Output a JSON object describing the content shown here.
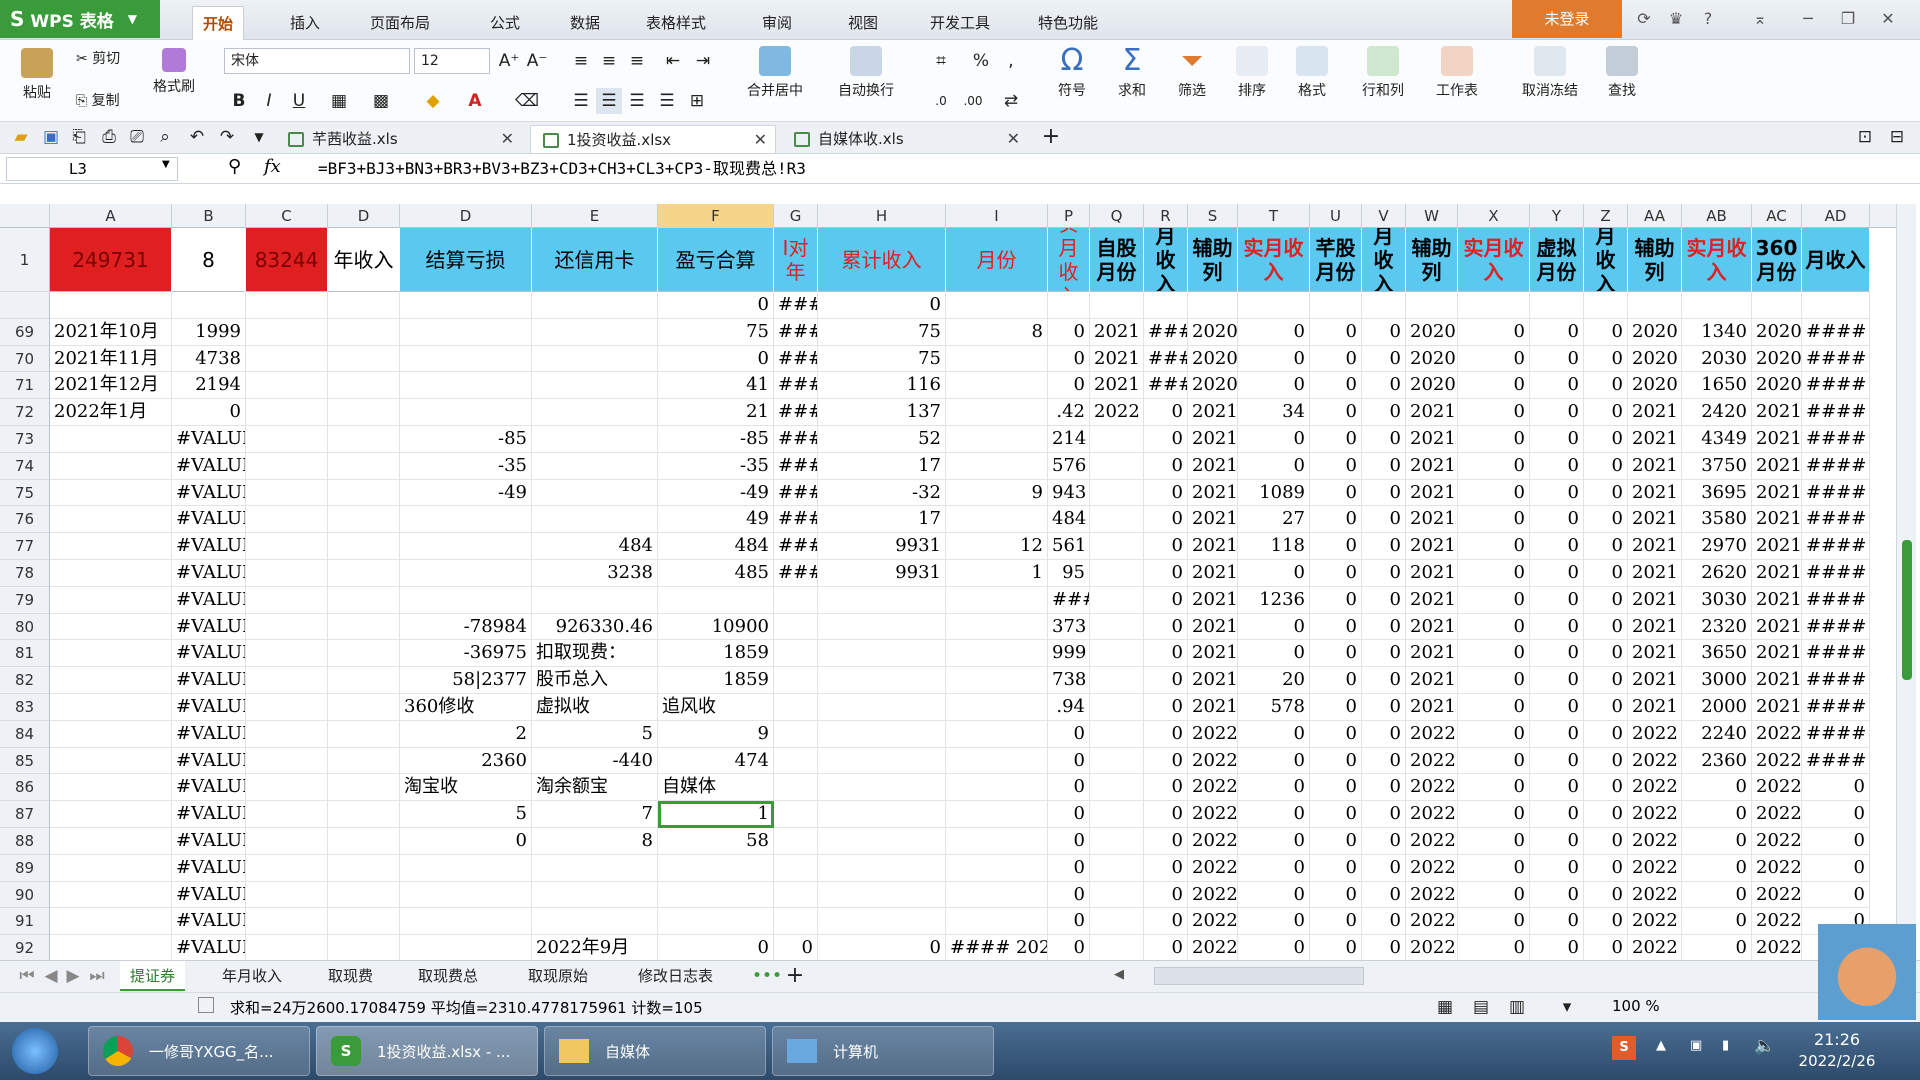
{
  "app": {
    "name": "WPS 表格",
    "login": "未登录"
  },
  "menu_tabs": [
    "开始",
    "插入",
    "页面布局",
    "公式",
    "数据",
    "表格样式",
    "审阅",
    "视图",
    "开发工具",
    "特色功能"
  ],
  "ribbon": {
    "paste": "粘贴",
    "cut": "剪切",
    "copy": "复制",
    "format_painter": "格式刷",
    "font": "宋体",
    "size": "12",
    "merge": "合并居中",
    "wrap": "自动换行",
    "symbol": "符号",
    "sum": "求和",
    "filter": "筛选",
    "sort": "排序",
    "format": "格式",
    "rowcol": "行和列",
    "worksheet": "工作表",
    "freeze": "取消冻结",
    "find": "查找"
  },
  "files": [
    {
      "name": "芊茜收益.xls",
      "active": false
    },
    {
      "name": "1投资收益.xlsx",
      "active": true
    },
    {
      "name": "自媒体收.xls",
      "active": false
    }
  ],
  "formula_bar": {
    "cell": "L3",
    "formula": "=BF3+BJ3+BN3+BR3+BV3+BZ3+CD3+CH3+CL3+CP3-取现费总!R3"
  },
  "columns": [
    "A",
    "B",
    "C",
    "D",
    "D",
    "E",
    "F",
    "G",
    "H",
    "I",
    "P",
    "Q",
    "R",
    "S",
    "T",
    "U",
    "V",
    "W",
    "X",
    "Y",
    "Z",
    "AA",
    "AB",
    "AC",
    "AD"
  ],
  "header_row": {
    "A": "249731",
    "B": "8",
    "C": "83244",
    "D1": "年收入",
    "D": "结算亏损",
    "E": "还信用卡",
    "F": "盈亏合算",
    "G": "I对年",
    "H": "累计收入",
    "I": "月份",
    "P": "实月收入",
    "Q": "自股月份",
    "R": "月收入",
    "S": "辅助列",
    "T": "实月收入",
    "U": "芊股月份",
    "V": "月收入",
    "W": "辅助列",
    "X": "实月收入",
    "Y": "虚拟月份",
    "Z": "月收入",
    "AA": "辅助列",
    "AB": "实月收入",
    "AC": "360月份",
    "AD": "月收入"
  },
  "rows": [
    {
      "n": "",
      "A": "",
      "B": "",
      "D": "",
      "E": "",
      "F": "0",
      "G": "###",
      "H": "0",
      "I": "",
      "P": "",
      "Q": "",
      "R": "",
      "S": "",
      "T": "",
      "U": "",
      "V": "",
      "W": "",
      "X": "",
      "Y": "",
      "Z": "",
      "AA": "",
      "AB": "",
      "AC": "",
      "AD": ""
    },
    {
      "n": "69",
      "A": "2021年10月",
      "B": "1999",
      "D": "",
      "E": "",
      "F": "75",
      "G": "###",
      "H": "75",
      "I": "8",
      "P": "0",
      "Q": "2021",
      "R": "####",
      "S": "2020",
      "T": "0",
      "U": "0",
      "V": "0",
      "W": "2020",
      "X": "0",
      "Y": "0",
      "Z": "0",
      "AA": "2020",
      "AB": "1340",
      "AC": "2020",
      "AD": "####"
    },
    {
      "n": "70",
      "A": "2021年11月",
      "B": "4738",
      "D": "",
      "E": "",
      "F": "0",
      "G": "###",
      "H": "75",
      "I": "",
      "P": "0",
      "Q": "2021",
      "R": "####",
      "S": "2020",
      "T": "0",
      "U": "0",
      "V": "0",
      "W": "2020",
      "X": "0",
      "Y": "0",
      "Z": "0",
      "AA": "2020",
      "AB": "2030",
      "AC": "2020",
      "AD": "####"
    },
    {
      "n": "71",
      "A": "2021年12月",
      "B": "2194",
      "D": "",
      "E": "",
      "F": "41",
      "G": "###",
      "H": "116",
      "I": "",
      "P": "0",
      "Q": "2021",
      "R": "####",
      "S": "2020",
      "T": "0",
      "U": "0",
      "V": "0",
      "W": "2020",
      "X": "0",
      "Y": "0",
      "Z": "0",
      "AA": "2020",
      "AB": "1650",
      "AC": "2020",
      "AD": "####"
    },
    {
      "n": "72",
      "A": "2022年1月",
      "B": "0",
      "D": "",
      "E": "",
      "F": "21",
      "G": "###",
      "H": "137",
      "I": "",
      "P": ".42",
      "Q": "2022",
      "R": "0",
      "S": "2021",
      "T": "34",
      "U": "0",
      "V": "0",
      "W": "2021",
      "X": "0",
      "Y": "0",
      "Z": "0",
      "AA": "2021",
      "AB": "2420",
      "AC": "2021",
      "AD": "####"
    },
    {
      "n": "73",
      "A": "",
      "B": "#VALUE!",
      "D": "-85",
      "E": "",
      "F": "-85",
      "G": "###",
      "H": "52",
      "I": "",
      "P": "214",
      "Q": "",
      "R": "0",
      "S": "2021",
      "T": "0",
      "U": "0",
      "V": "0",
      "W": "2021",
      "X": "0",
      "Y": "0",
      "Z": "0",
      "AA": "2021",
      "AB": "4349",
      "AC": "2021",
      "AD": "####"
    },
    {
      "n": "74",
      "A": "",
      "B": "#VALUE!",
      "D": "-35",
      "E": "",
      "F": "-35",
      "G": "###",
      "H": "17",
      "I": "",
      "P": "576",
      "Q": "",
      "R": "0",
      "S": "2021",
      "T": "0",
      "U": "0",
      "V": "0",
      "W": "2021",
      "X": "0",
      "Y": "0",
      "Z": "0",
      "AA": "2021",
      "AB": "3750",
      "AC": "2021",
      "AD": "####"
    },
    {
      "n": "75",
      "A": "",
      "B": "#VALUE!",
      "D": "-49",
      "E": "",
      "F": "-49",
      "G": "###",
      "H": "-32",
      "I": "9",
      "P": "943",
      "Q": "",
      "R": "0",
      "S": "2021",
      "T": "1089",
      "U": "0",
      "V": "0",
      "W": "2021",
      "X": "0",
      "Y": "0",
      "Z": "0",
      "AA": "2021",
      "AB": "3695",
      "AC": "2021",
      "AD": "####"
    },
    {
      "n": "76",
      "A": "",
      "B": "#VALUE!",
      "D": "",
      "E": "",
      "F": "49",
      "G": "###",
      "H": "17",
      "I": "",
      "P": "484",
      "Q": "",
      "R": "0",
      "S": "2021",
      "T": "27",
      "U": "0",
      "V": "0",
      "W": "2021",
      "X": "0",
      "Y": "0",
      "Z": "0",
      "AA": "2021",
      "AB": "3580",
      "AC": "2021",
      "AD": "####"
    },
    {
      "n": "77",
      "A": "",
      "B": "#VALUE!",
      "D": "",
      "E": "484",
      "F": "484",
      "G": "###",
      "H": "9931",
      "I": "12",
      "P": "561",
      "Q": "",
      "R": "0",
      "S": "2021",
      "T": "118",
      "U": "0",
      "V": "0",
      "W": "2021",
      "X": "0",
      "Y": "0",
      "Z": "0",
      "AA": "2021",
      "AB": "2970",
      "AC": "2021",
      "AD": "####"
    },
    {
      "n": "78",
      "A": "",
      "B": "#VALUE!",
      "D": "",
      "E": "3238",
      "F": "485",
      "G": "###",
      "H": "9931",
      "I": "1",
      "P": "95",
      "Q": "",
      "R": "0",
      "S": "2021",
      "T": "0",
      "U": "0",
      "V": "0",
      "W": "2021",
      "X": "0",
      "Y": "0",
      "Z": "0",
      "AA": "2021",
      "AB": "2620",
      "AC": "2021",
      "AD": "####"
    },
    {
      "n": "79",
      "A": "",
      "B": "#VALUE!",
      "D": "",
      "E": "",
      "F": "",
      "G": "",
      "H": "",
      "I": "",
      "P": "###",
      "Q": "",
      "R": "0",
      "S": "2021",
      "T": "1236",
      "U": "0",
      "V": "0",
      "W": "2021",
      "X": "0",
      "Y": "0",
      "Z": "0",
      "AA": "2021",
      "AB": "3030",
      "AC": "2021",
      "AD": "####"
    },
    {
      "n": "80",
      "A": "",
      "B": "#VALUE!",
      "D": "-78984",
      "E": "926330.46",
      "F": "10900",
      "G": "",
      "H": "",
      "I": "",
      "P": "373",
      "Q": "",
      "R": "0",
      "S": "2021",
      "T": "0",
      "U": "0",
      "V": "0",
      "W": "2021",
      "X": "0",
      "Y": "0",
      "Z": "0",
      "AA": "2021",
      "AB": "2320",
      "AC": "2021",
      "AD": "####"
    },
    {
      "n": "81",
      "A": "",
      "B": "#VALUE!",
      "D": "-36975",
      "E": "扣取现费：",
      "F": "1859",
      "G": "",
      "H": "",
      "I": "",
      "P": "999",
      "Q": "",
      "R": "0",
      "S": "2021",
      "T": "0",
      "U": "0",
      "V": "0",
      "W": "2021",
      "X": "0",
      "Y": "0",
      "Z": "0",
      "AA": "2021",
      "AB": "3650",
      "AC": "2021",
      "AD": "####"
    },
    {
      "n": "82",
      "A": "",
      "B": "#VALUE!",
      "D": "58|2377",
      "E": "股币总入",
      "F": "1859",
      "G": "",
      "H": "",
      "I": "",
      "P": "738",
      "Q": "",
      "R": "0",
      "S": "2021",
      "T": "20",
      "U": "0",
      "V": "0",
      "W": "2021",
      "X": "0",
      "Y": "0",
      "Z": "0",
      "AA": "2021",
      "AB": "3000",
      "AC": "2021",
      "AD": "####"
    },
    {
      "n": "83",
      "A": "",
      "B": "#VALUE!",
      "D": "360修收",
      "E": "虚拟收",
      "F": "追风收",
      "G": "",
      "H": "",
      "I": "",
      "P": ".94",
      "Q": "",
      "R": "0",
      "S": "2021",
      "T": "578",
      "U": "0",
      "V": "0",
      "W": "2021",
      "X": "0",
      "Y": "0",
      "Z": "0",
      "AA": "2021",
      "AB": "2000",
      "AC": "2021",
      "AD": "####"
    },
    {
      "n": "84",
      "A": "",
      "B": "#VALUE!",
      "D": "2",
      "E": "5",
      "F": "9",
      "G": "",
      "H": "",
      "I": "",
      "P": "0",
      "Q": "",
      "R": "0",
      "S": "2022",
      "T": "0",
      "U": "0",
      "V": "0",
      "W": "2022",
      "X": "0",
      "Y": "0",
      "Z": "0",
      "AA": "2022",
      "AB": "2240",
      "AC": "2022",
      "AD": "####"
    },
    {
      "n": "85",
      "A": "",
      "B": "#VALUE!",
      "D": "2360",
      "E": "-440",
      "F": "474",
      "G": "",
      "H": "",
      "I": "",
      "P": "0",
      "Q": "",
      "R": "0",
      "S": "2022",
      "T": "0",
      "U": "0",
      "V": "0",
      "W": "2022",
      "X": "0",
      "Y": "0",
      "Z": "0",
      "AA": "2022",
      "AB": "2360",
      "AC": "2022",
      "AD": "####"
    },
    {
      "n": "86",
      "A": "",
      "B": "#VALUE!",
      "D": "淘宝收",
      "E": "淘余额宝",
      "F": "自媒体",
      "G": "",
      "H": "",
      "I": "",
      "P": "0",
      "Q": "",
      "R": "0",
      "S": "2022",
      "T": "0",
      "U": "0",
      "V": "0",
      "W": "2022",
      "X": "0",
      "Y": "0",
      "Z": "0",
      "AA": "2022",
      "AB": "0",
      "AC": "2022",
      "AD": "0"
    },
    {
      "n": "87",
      "A": "",
      "B": "#VALUE!",
      "D": "5",
      "E": "7",
      "F": "1",
      "G": "",
      "H": "",
      "I": "",
      "P": "0",
      "Q": "",
      "R": "0",
      "S": "2022",
      "T": "0",
      "U": "0",
      "V": "0",
      "W": "2022",
      "X": "0",
      "Y": "0",
      "Z": "0",
      "AA": "2022",
      "AB": "0",
      "AC": "2022",
      "AD": "0"
    },
    {
      "n": "88",
      "A": "",
      "B": "#VALUE!",
      "D": "0",
      "E": "8",
      "F": "58",
      "G": "",
      "H": "",
      "I": "",
      "P": "0",
      "Q": "",
      "R": "0",
      "S": "2022",
      "T": "0",
      "U": "0",
      "V": "0",
      "W": "2022",
      "X": "0",
      "Y": "0",
      "Z": "0",
      "AA": "2022",
      "AB": "0",
      "AC": "2022",
      "AD": "0"
    },
    {
      "n": "89",
      "A": "",
      "B": "#VALUE!",
      "D": "",
      "E": "",
      "F": "",
      "G": "",
      "H": "",
      "I": "",
      "P": "0",
      "Q": "",
      "R": "0",
      "S": "2022",
      "T": "0",
      "U": "0",
      "V": "0",
      "W": "2022",
      "X": "0",
      "Y": "0",
      "Z": "0",
      "AA": "2022",
      "AB": "0",
      "AC": "2022",
      "AD": "0"
    },
    {
      "n": "90",
      "A": "",
      "B": "#VALUE!",
      "D": "",
      "E": "",
      "F": "",
      "G": "",
      "H": "",
      "I": "",
      "P": "0",
      "Q": "",
      "R": "0",
      "S": "2022",
      "T": "0",
      "U": "0",
      "V": "0",
      "W": "2022",
      "X": "0",
      "Y": "0",
      "Z": "0",
      "AA": "2022",
      "AB": "0",
      "AC": "2022",
      "AD": "0"
    },
    {
      "n": "91",
      "A": "",
      "B": "#VALUE!",
      "D": "",
      "E": "",
      "F": "",
      "G": "",
      "H": "",
      "I": "",
      "P": "0",
      "Q": "",
      "R": "0",
      "S": "2022",
      "T": "0",
      "U": "0",
      "V": "0",
      "W": "2022",
      "X": "0",
      "Y": "0",
      "Z": "0",
      "AA": "2022",
      "AB": "0",
      "AC": "2022",
      "AD": "0"
    },
    {
      "n": "92",
      "A": "",
      "B": "#VALUE!",
      "D": "",
      "E": "2022年9月",
      "F": "0",
      "G": "0",
      "H": "0",
      "I": "#### 2022",
      "P": "0",
      "Q": "",
      "R": "0",
      "S": "2022",
      "T": "0",
      "U": "0",
      "V": "0",
      "W": "2022",
      "X": "0",
      "Y": "0",
      "Z": "0",
      "AA": "2022",
      "AB": "0",
      "AC": "2022",
      "AD": "0"
    }
  ],
  "sheet_tabs": [
    "提证券",
    "年月收入",
    "取现费",
    "取现费总",
    "取现原始",
    "修改日志表"
  ],
  "status": {
    "text": "求和=24万2600.17084759  平均值=2310.4778175961  计数=105",
    "zoom": "100 %"
  },
  "taskbar": {
    "items": [
      "一修哥YXGG_名...",
      "1投资收益.xlsx - ...",
      "自媒体",
      "计算机"
    ],
    "time": "21:26",
    "date": "2022/2/26"
  },
  "colors": {
    "green": "#3a9b3a",
    "header_blue": "#5bc8ef",
    "header_red": "#e02020",
    "accent_orange": "#e07a2c"
  }
}
